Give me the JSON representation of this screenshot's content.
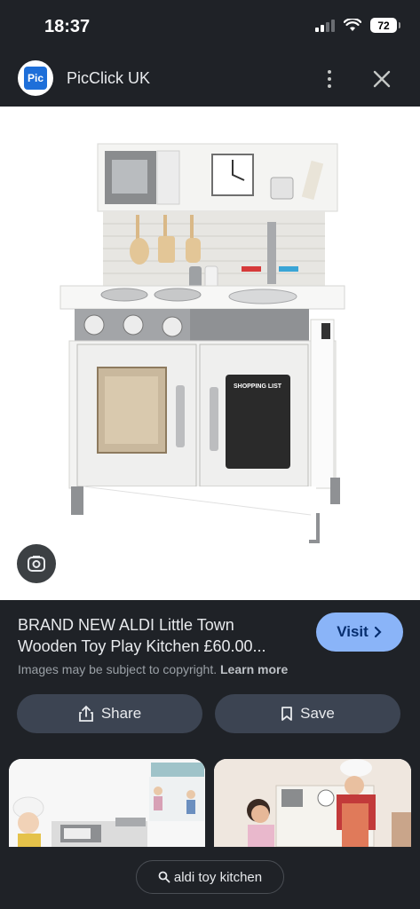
{
  "status_bar": {
    "time": "18:37",
    "battery": "72"
  },
  "app_bar": {
    "logo_text": "Pic",
    "site_name": "PicClick UK"
  },
  "result": {
    "title_line1": "BRAND NEW ALDI Little Town",
    "title_line2": "Wooden Toy Play Kitchen £60.00...",
    "visit_label": "Visit",
    "copyright_text": "Images may be subject to copyright.",
    "learn_more": "Learn more",
    "share_label": "Share",
    "save_label": "Save"
  },
  "product_image": {
    "chalkboard_text": "SHOPPING LIST"
  },
  "search_chip": {
    "query": "aldi toy kitchen"
  },
  "colors": {
    "background": "#1f2227",
    "visit_button": "#8ab4f8",
    "action_button": "#3c4452"
  }
}
